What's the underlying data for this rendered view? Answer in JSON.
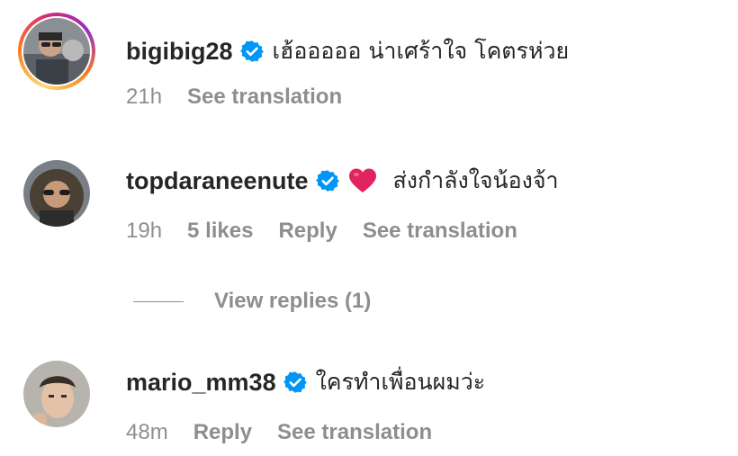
{
  "comments": [
    {
      "username": "bigibig28",
      "verified": true,
      "story_ring": true,
      "text": "เฮ้อออออ น่าเศร้าใจ โคตรห่วย",
      "time": "21h",
      "likes": "",
      "reply": "",
      "translate": "See translation"
    },
    {
      "username": "topdaraneenute",
      "verified": true,
      "story_ring": false,
      "emoji": "red-heart-emoji",
      "text": "ส่งกำลังใจน้องจ้า",
      "time": "19h",
      "likes": "5 likes",
      "reply": "Reply",
      "translate": "See translation",
      "view_replies": "View replies (1)"
    },
    {
      "username": "mario_mm38",
      "verified": true,
      "story_ring": false,
      "text": "ใครทำเพื่อนผมว่ะ",
      "time": "48m",
      "likes": "",
      "reply": "Reply",
      "translate": "See translation"
    }
  ],
  "colors": {
    "text": "#262626",
    "secondary": "#8e8e8e",
    "verified_blue": "#0095f6",
    "heart_red": "#e0245e"
  }
}
